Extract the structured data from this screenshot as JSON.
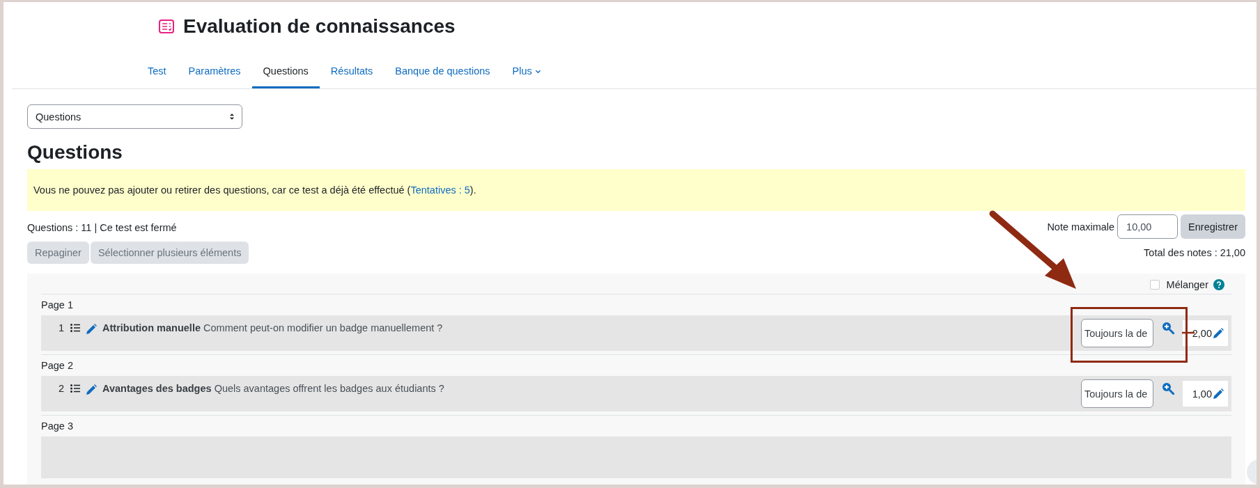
{
  "page": {
    "title": "Evaluation de connaissances"
  },
  "tabs": [
    {
      "label": "Test",
      "selected": false,
      "kind": "link"
    },
    {
      "label": "Paramètres",
      "selected": false,
      "kind": "link"
    },
    {
      "label": "Questions",
      "selected": true,
      "kind": "link"
    },
    {
      "label": "Résultats",
      "selected": false,
      "kind": "link"
    },
    {
      "label": "Banque de questions",
      "selected": false,
      "kind": "link"
    },
    {
      "label": "Plus",
      "selected": false,
      "kind": "menu"
    }
  ],
  "section_select": {
    "value": "Questions"
  },
  "heading": "Questions",
  "alert": {
    "text": "Vous ne pouvez pas ajouter ou retirer des questions, car ce test a déjà été effectué (",
    "link": "Tentatives : 5",
    "text_after": ")."
  },
  "summary": "Questions : 11 | Ce test est fermé",
  "buttons": [
    {
      "label": "Repaginer",
      "disabled": true
    },
    {
      "label": "Sélectionner plusieurs éléments",
      "disabled": true
    }
  ],
  "max_grade": {
    "label": "Note maximale",
    "value": "10,00",
    "button": "Enregistrer"
  },
  "total": "Total des notes : 21,00",
  "shuffle": {
    "label": "Mélanger",
    "checked": false
  },
  "pages": [
    {
      "label": "Page 1",
      "questions": [
        {
          "kind": "full",
          "number": "1",
          "name": "Attribution manuelle",
          "text": "Comment peut-on modifier  un badge manuellement ?",
          "behaviour": "Toujours la de",
          "mark": "2,00",
          "highlighted": true
        }
      ]
    },
    {
      "label": "Page 2",
      "questions": [
        {
          "kind": "full",
          "number": "2",
          "name": "Avantages des badges",
          "text": "Quels avantages offrent les badges aux étudiants ?",
          "behaviour": "Toujours la de",
          "mark": "1,00",
          "highlighted": false
        }
      ]
    },
    {
      "label": "Page 3",
      "questions": [
        {
          "kind": "partial"
        }
      ]
    }
  ]
}
